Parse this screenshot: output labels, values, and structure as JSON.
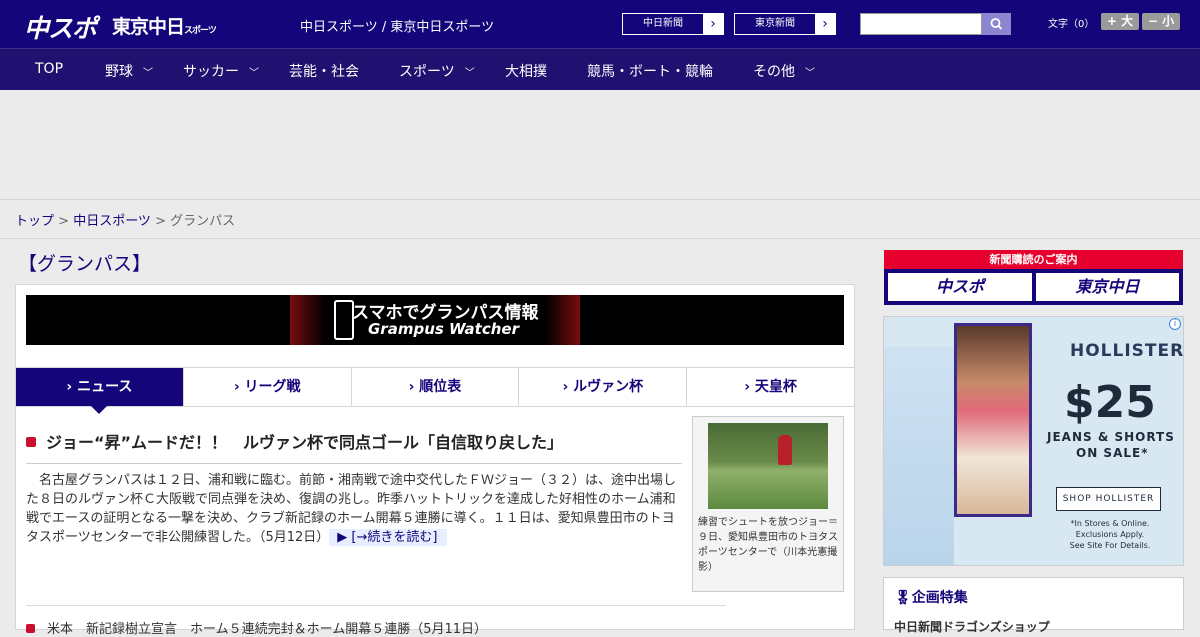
{
  "header": {
    "logo": "中スポ",
    "logo2": "東京中日",
    "logo2_small": "スポーツ",
    "site_name": "中日スポーツ / 東京中日スポーツ",
    "links": [
      {
        "label": "中日新聞"
      },
      {
        "label": "東京新聞"
      }
    ],
    "search_placeholder": "",
    "font_label": "文字（0）",
    "font_plus": "+ 大",
    "font_minus": "− 小"
  },
  "nav": [
    {
      "label": "TOP",
      "has_menu": false
    },
    {
      "label": "野球",
      "has_menu": true
    },
    {
      "label": "サッカー",
      "has_menu": true
    },
    {
      "label": "芸能・社会",
      "has_menu": false
    },
    {
      "label": "スポーツ",
      "has_menu": true
    },
    {
      "label": "大相撲",
      "has_menu": false
    },
    {
      "label": "競馬・ボート・競輪",
      "has_menu": false
    },
    {
      "label": "その他",
      "has_menu": true
    }
  ],
  "breadcrumb": {
    "top": "トップ",
    "sep": " > ",
    "mid": "中日スポーツ",
    "current": "グランパス"
  },
  "page_heading": "【グランパス】",
  "banner": {
    "line1": "スマホでグランパス情報",
    "line2": "Grampus Watcher"
  },
  "tabs": [
    {
      "label": "› ニュース",
      "active": true
    },
    {
      "label": "› リーグ戦",
      "active": false
    },
    {
      "label": "› 順位表",
      "active": false
    },
    {
      "label": "› ルヴァン杯",
      "active": false
    },
    {
      "label": "› 天皇杯",
      "active": false
    }
  ],
  "article": {
    "title": "ジョー“昇”ムードだ！！　ルヴァン杯で同点ゴール「自信取り戻した」",
    "body": "名古屋グランパスは１２日、浦和戦に臨む。前節・湘南戦で途中交代したＦＷジョー（３２）は、途中出場した８日のルヴァン杯Ｃ大阪戦で同点弾を決め、復調の兆し。昨季ハットトリックを達成した好相性のホーム浦和戦でエースの証明となる一撃を決め、クラブ新記録のホーム開幕５連勝に導く。１１日は、愛知県豊田市のトヨタスポーツセンターで非公開練習した。",
    "date": "（5月12日）",
    "more": "▶ [→続きを読む]",
    "photo_caption": "練習でシュートを放つジョー＝９日、愛知県豊田市のトヨタスポーツセンターで（川本光憲撮影）"
  },
  "next_item": {
    "title": "米本　新記録樹立宣言　ホーム５連続完封＆ホーム開幕５連勝（5月11日）"
  },
  "subscribe": {
    "heading": "新聞購読のご案内",
    "btn1": "中スポ",
    "btn2": "東京中日"
  },
  "side_ad": {
    "brand": "HOLLISTER",
    "price": "$25",
    "line1": "JEANS & SHORTS",
    "line2": "ON SALE*",
    "cta": "SHOP HOLLISTER",
    "fine": "*In Stores & Online. Exclusions Apply. See Site For Details.",
    "info": "i"
  },
  "feature": {
    "heading": "企画特集",
    "row1": "中日新聞ドラゴンズショップ"
  },
  "colors": {
    "brand": "#15057a",
    "accent": "#c8102e",
    "red": "#e6002d"
  }
}
